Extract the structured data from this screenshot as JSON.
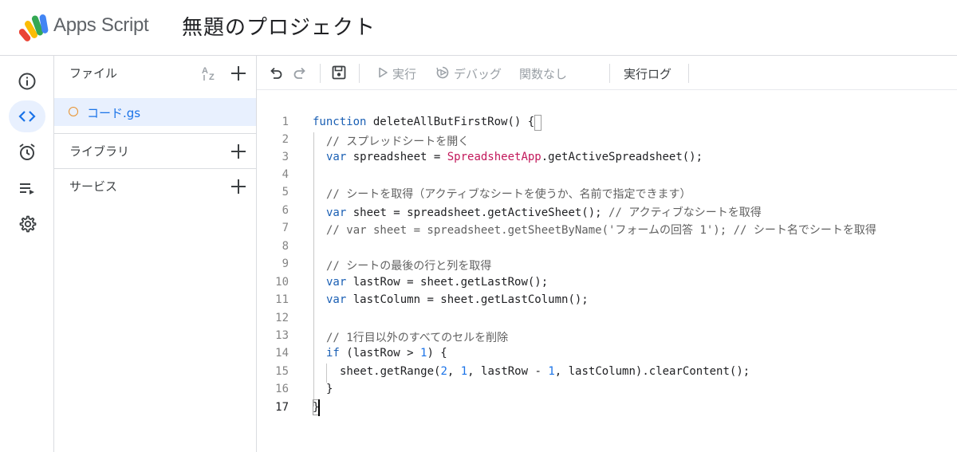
{
  "header": {
    "app_name": "Apps Script",
    "project_title": "無題のプロジェクト"
  },
  "rail": {
    "items": [
      {
        "name": "overview",
        "icon": "info-icon"
      },
      {
        "name": "editor",
        "icon": "code-icon",
        "active": true
      },
      {
        "name": "triggers",
        "icon": "alarm-clock-icon"
      },
      {
        "name": "executions",
        "icon": "executions-list-icon"
      },
      {
        "name": "settings",
        "icon": "gear-icon"
      }
    ]
  },
  "files_panel": {
    "files_label": "ファイル",
    "sort_icon": "sort-az-icon",
    "add_icon": "plus-icon",
    "files": [
      {
        "name": "コード.gs",
        "status_color": "#e8912d"
      }
    ],
    "libraries_label": "ライブラリ",
    "services_label": "サービス"
  },
  "toolbar": {
    "undo_icon": "undo-icon",
    "redo_icon": "redo-icon",
    "save_icon": "save-icon",
    "run_label": "実行",
    "debug_label": "デバッグ",
    "function_select": "関数なし",
    "execution_log_label": "実行ログ"
  },
  "editor": {
    "current_line": 17,
    "lines": [
      {
        "n": "1"
      },
      {
        "n": "2"
      },
      {
        "n": "3"
      },
      {
        "n": "4"
      },
      {
        "n": "5"
      },
      {
        "n": "6"
      },
      {
        "n": "7"
      },
      {
        "n": "8"
      },
      {
        "n": "9"
      },
      {
        "n": "10"
      },
      {
        "n": "11"
      },
      {
        "n": "12"
      },
      {
        "n": "13"
      },
      {
        "n": "14"
      },
      {
        "n": "15"
      },
      {
        "n": "16"
      },
      {
        "n": "17"
      }
    ],
    "code": {
      "l1_kw": "function",
      "l1_rest": " deleteAllButFirstRow() {",
      "l2": "// スプレッドシートを開く",
      "l3_kw": "var",
      "l3_a": " spreadsheet = ",
      "l3_cls": "SpreadsheetApp",
      "l3_b": ".getActiveSpreadsheet();",
      "l5": "// シートを取得（アクティブなシートを使うか、名前で指定できます）",
      "l6_kw": "var",
      "l6_a": " sheet = spreadsheet.getActiveSheet(); ",
      "l6_cm": "// アクティブなシートを取得",
      "l7": "// var sheet = spreadsheet.getSheetByName('フォームの回答 1'); // シート名でシートを取得",
      "l9": "// シートの最後の行と列を取得",
      "l10_kw": "var",
      "l10_a": " lastRow = sheet.getLastRow();",
      "l11_kw": "var",
      "l11_a": " lastColumn = sheet.getLastColumn();",
      "l13": "// 1行目以外のすべてのセルを削除",
      "l14_kw": "if",
      "l14_a": " (lastRow > ",
      "l14_num": "1",
      "l14_b": ") {",
      "l15_a": "sheet.getRange(",
      "l15_n1": "2",
      "l15_b": ", ",
      "l15_n2": "1",
      "l15_c": ", lastRow - ",
      "l15_n3": "1",
      "l15_d": ", lastColumn).clearContent();",
      "l16": "}",
      "l17": "}"
    }
  }
}
